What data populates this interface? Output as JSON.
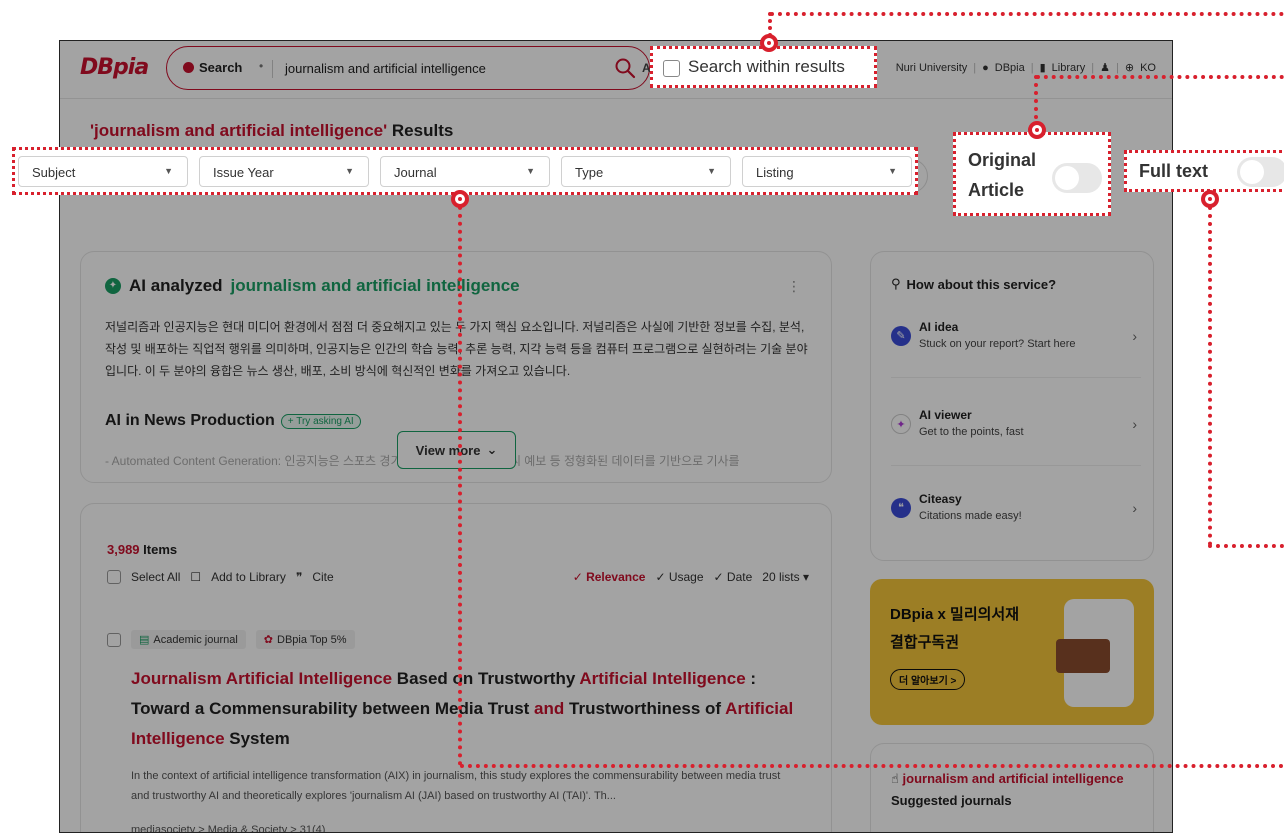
{
  "header": {
    "logo": "DBpia",
    "search_scope": "Search",
    "search_query": "journalism and artificial intelligence",
    "az_label": "A",
    "nav": {
      "university": "Nuri University",
      "dbpia": "DBpia",
      "library": "Library",
      "lang": "KO"
    }
  },
  "results_title": {
    "keyword": "'journalism and artificial intelligence'",
    "suffix": " Results"
  },
  "filters": [
    {
      "label": "Subject"
    },
    {
      "label": "Issue Year"
    },
    {
      "label": "Journal"
    },
    {
      "label": "Type"
    },
    {
      "label": "Listing"
    }
  ],
  "popups": {
    "search_within": "Search within results",
    "original_line1": "Original",
    "original_line2": "Article",
    "full_text": "Full text"
  },
  "ai_card": {
    "prefix": "AI analyzed",
    "keyword": "journalism and artificial intelligence",
    "more_icon": "⋮",
    "paragraph": "저널리즘과 인공지능은 현대 미디어 환경에서 점점 더 중요해지고 있는 두 가지 핵심 요소입니다. 저널리즘은 사실에 기반한 정보를 수집, 분석, 작성 및 배포하는 직업적 행위를 의미하며, 인공지능은 인간의 학습 능력, 추론 능력, 지각 능력 등을 컴퓨터 프로그램으로 실현하려는 기술 분야입니다. 이 두 분야의 융합은 뉴스 생산, 배포, 소비 방식에 혁신적인 변화를 가져오고 있습니다.",
    "subheading": "AI in News Production",
    "try_label": "+ Try asking AI",
    "faded_line": "- Automated Content Generation: 인공지능은 스포츠 경기 결과, 금융 보고서, 날씨 예보 등 정형화된 데이터를 기반으로 기사를",
    "view_more": "View more"
  },
  "results": {
    "count": "3,989",
    "count_suffix": " Items",
    "select_all": "Select All",
    "add_library": "Add to Library",
    "cite": "Cite",
    "sort": {
      "relevance": "✓ Relevance",
      "usage": "✓ Usage",
      "date": "✓ Date",
      "lists": "20 lists ▾"
    },
    "item": {
      "tag1": "Academic journal",
      "tag2": "DBpia Top 5%",
      "title_parts": [
        {
          "t": "Journalism Artificial Intelligence",
          "kw": true
        },
        {
          "t": " Based on Trustworthy ",
          "kw": false
        },
        {
          "t": "Artificial Intelligence",
          "kw": true
        },
        {
          "t": " : Toward a Commensurability between Media Trust ",
          "kw": false
        },
        {
          "t": "and",
          "kw": true
        },
        {
          "t": " Trustworthiness of ",
          "kw": false
        },
        {
          "t": "Artificial Intelligence",
          "kw": true
        },
        {
          "t": " System",
          "kw": false
        }
      ],
      "abstract": "In the context of artificial intelligence transformation (AIX) in journalism, this study explores the commensurability between media trust and trustworthy AI and theoretically explores 'journalism AI (JAI) based on trustworthy AI (TAI)'. Th...",
      "crumbs": "mediasociety  >  Media & Society  >  31(4)"
    }
  },
  "service": {
    "heading": "How about this service?",
    "items": [
      {
        "name": "AI idea",
        "desc": "Stuck on your report? Start here",
        "icon": "ai-idea-icon",
        "color": "#3a4bd8"
      },
      {
        "name": "AI viewer",
        "desc": "Get to the points, fast",
        "icon": "ai-viewer-icon",
        "color": "#b03ad8"
      },
      {
        "name": "Citeasy",
        "desc": "Citations made easy!",
        "icon": "citeasy-icon",
        "color": "#3a4bd8"
      }
    ]
  },
  "banner": {
    "line1": "DBpia x 밀리의서재",
    "line2": "결합구독권",
    "button": "더 알아보기 >"
  },
  "suggested": {
    "keyword": "journalism and artificial intelligence",
    "suffix": " Suggested journals"
  },
  "colors": {
    "brand": "#c8102e",
    "accent_green": "#1a9e64",
    "highlight": "#d8202d"
  }
}
